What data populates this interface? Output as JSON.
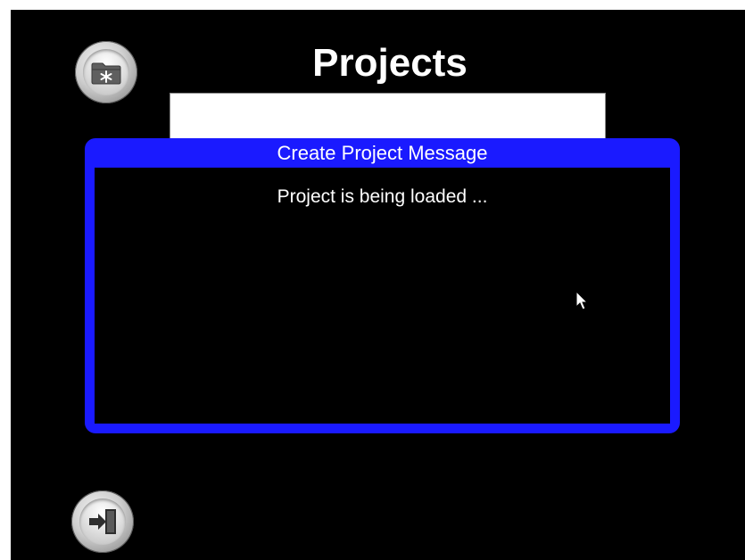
{
  "header": {
    "title": "Projects"
  },
  "project_name_field": {
    "value": ""
  },
  "dialog": {
    "title": "Create Project Message",
    "message": "Project is being loaded ..."
  },
  "buttons": {
    "new_project_icon": "folder-star-icon",
    "exit_icon": "exit-door-icon"
  },
  "colors": {
    "screen_background": "#000000",
    "dialog_frame": "#1a1aff",
    "text": "#ffffff"
  }
}
